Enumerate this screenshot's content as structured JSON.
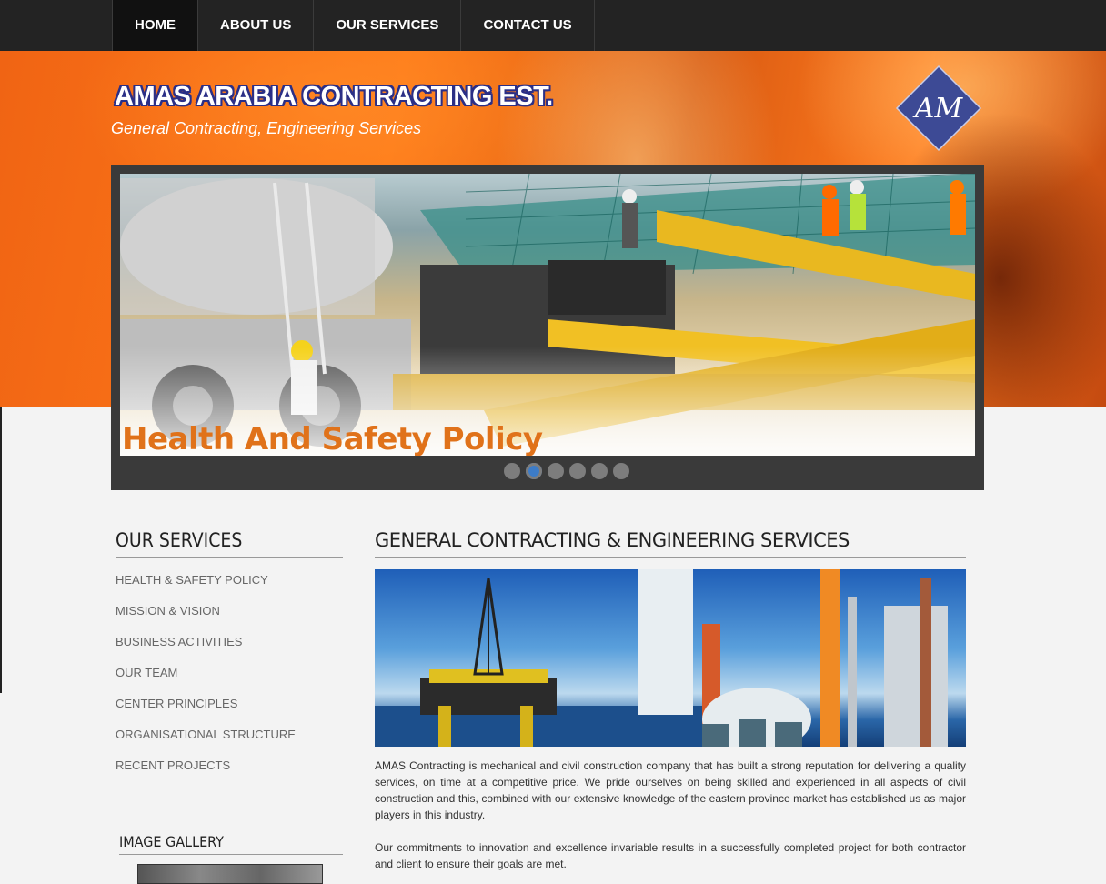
{
  "nav": {
    "items": [
      {
        "label": "HOME",
        "active": true
      },
      {
        "label": "ABOUT US",
        "active": false
      },
      {
        "label": "OUR SERVICES",
        "active": false
      },
      {
        "label": "CONTACT US",
        "active": false
      }
    ]
  },
  "header": {
    "title": "AMAS ARABIA CONTRACTING EST.",
    "subtitle": "General Contracting, Engineering Services",
    "logo_text": "AM",
    "logo_color": "#3d4a95"
  },
  "slider": {
    "caption": "Health And Safety Policy",
    "slide_count": 6,
    "active_index": 1,
    "caption_color": "#e0721a"
  },
  "sidebar": {
    "services_heading": "OUR SERVICES",
    "services": [
      "HEALTH & SAFETY POLICY",
      "MISSION & VISION",
      "BUSINESS ACTIVITIES",
      "OUR TEAM",
      "CENTER PRINCIPLES",
      "ORGANISATIONAL STRUCTURE",
      "RECENT PROJECTS"
    ],
    "gallery_heading": "IMAGE GALLERY"
  },
  "main": {
    "heading": "GENERAL CONTRACTING & ENGINEERING SERVICES",
    "paragraphs": [
      "AMAS Contracting is mechanical and civil construction company that has built a strong reputation for delivering a quality services, on time at a competitive price. We pride ourselves on being skilled and experienced in all aspects of civil construction and this, combined with our extensive knowledge of the eastern province market has established us as major players in this industry.",
      "Our commitments to innovation and excellence invariable results in a successfully completed project for both contractor and client to ensure their goals are met."
    ]
  },
  "colors": {
    "nav_bg": "#232323",
    "hero_orange": "#f06414",
    "brand_outline": "#2b2f86",
    "dot_active": "#3d7cc8"
  }
}
